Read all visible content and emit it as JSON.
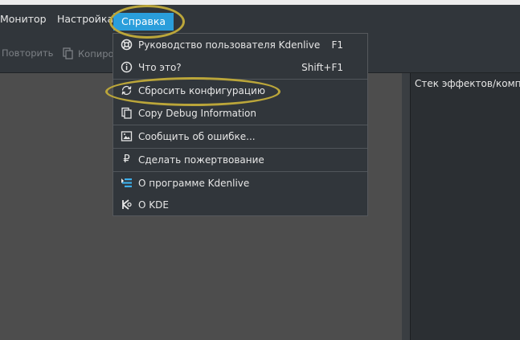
{
  "menubar": {
    "items": [
      {
        "label": "Монитор"
      },
      {
        "label": "Настройка"
      },
      {
        "label": "Справка",
        "active": true
      }
    ]
  },
  "toolbar": {
    "redo_label": "Повторить",
    "copy_label": "Копиров"
  },
  "right_panel": {
    "title": "Стек эффектов/компози"
  },
  "help_menu": {
    "items": [
      {
        "label": "Руководство пользователя Kdenlive",
        "shortcut": "F1",
        "icon": "help-lifebuoy-icon"
      },
      {
        "label": "Что это?",
        "shortcut": "Shift+F1",
        "icon": "info-icon"
      },
      {
        "label": "Сбросить конфигурацию",
        "shortcut": "",
        "icon": "reset-icon"
      },
      {
        "label": "Copy Debug Information",
        "shortcut": "",
        "icon": "copy-icon"
      },
      {
        "label": "Сообщить об ошибке...",
        "shortcut": "",
        "icon": "bug-report-icon"
      },
      {
        "label": "Сделать пожертвование",
        "shortcut": "",
        "icon": "ruble-icon"
      },
      {
        "label": "О программе Kdenlive",
        "shortcut": "",
        "icon": "kdenlive-logo-icon"
      },
      {
        "label": "О KDE",
        "shortcut": "",
        "icon": "kde-logo-icon"
      }
    ]
  },
  "colors": {
    "menu_bg": "#31363b",
    "accent": "#2a9edb",
    "annotation": "#bba63a",
    "workarea": "#4d4d4d"
  }
}
